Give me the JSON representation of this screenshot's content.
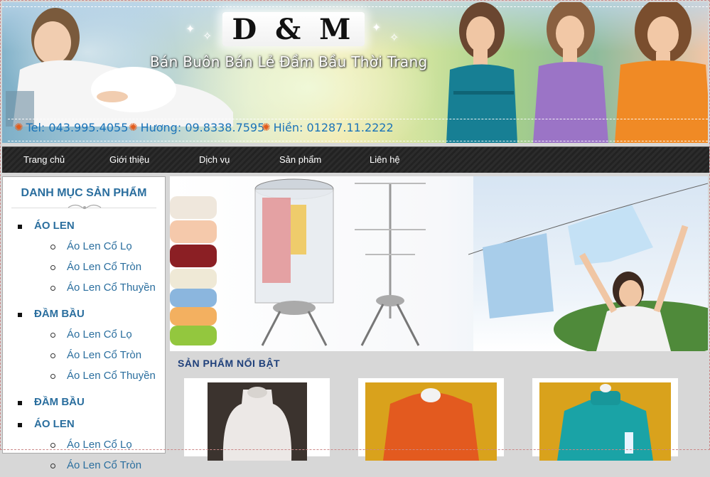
{
  "header": {
    "logo": "D & M",
    "tagline": "Bán Buôn Bán Lẻ Đầm Bầu Thời Trang",
    "contacts": [
      "Tel: 043.995.4055",
      "Hương: 09.8338.7595",
      "Hiền: 01287.11.2222"
    ],
    "colors": {
      "contact_text": "#1a73b8",
      "star": "#e35b1a"
    }
  },
  "nav": {
    "items": [
      "Trang chủ",
      "Giới thiệu",
      "Dịch vụ",
      "Sản phẩm",
      "Liên hệ"
    ]
  },
  "sidebar": {
    "title": "DANH MỤC SẢN PHẨM",
    "categories": [
      {
        "label": "ÁO LEN",
        "subs": [
          "Áo Len Cổ Lọ",
          "Áo Len Cổ Tròn",
          "Áo Len Cổ Thuyền"
        ]
      },
      {
        "label": "ĐẦM BẦU",
        "subs": [
          "Áo Len Cổ Lọ",
          "Áo Len Cổ Tròn",
          "Áo Len Cổ Thuyền"
        ]
      },
      {
        "label": "ĐẦM BẦU",
        "subs": []
      },
      {
        "label": "ÁO LEN",
        "subs": [
          "Áo Len Cổ Lọ",
          "Áo Len Cổ Tròn"
        ]
      }
    ],
    "colors": {
      "link": "#2a6e9e"
    }
  },
  "main": {
    "featured_title": "SẢN PHẨM NỔI BẬT",
    "products": [
      {
        "icon": "white-top-photo",
        "color": "#ece8e6"
      },
      {
        "icon": "orange-sweater-photo",
        "color": "#e35a1f"
      },
      {
        "icon": "teal-turtleneck-photo",
        "color": "#1aa3a6"
      }
    ]
  }
}
